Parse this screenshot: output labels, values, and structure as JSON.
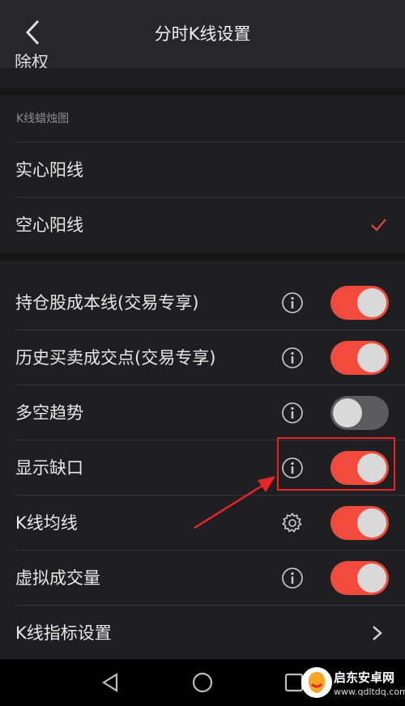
{
  "header": {
    "title": "分时K线设置",
    "peek_text": "除权"
  },
  "candle_section": {
    "label": "K线蜡烛图",
    "options": [
      {
        "label": "实心阳线",
        "selected": false
      },
      {
        "label": "空心阳线",
        "selected": true
      }
    ]
  },
  "settings": [
    {
      "label": "持仓股成本线(交易专享)",
      "icon": "info-icon",
      "on": true
    },
    {
      "label": "历史买卖成交点(交易专享)",
      "icon": "info-icon",
      "on": true
    },
    {
      "label": "多空趋势",
      "icon": "info-icon",
      "on": false
    },
    {
      "label": "显示缺口",
      "icon": "info-icon",
      "on": true
    },
    {
      "label": "K线均线",
      "icon": "gear-icon",
      "on": true
    },
    {
      "label": "虚拟成交量",
      "icon": "info-icon",
      "on": true
    }
  ],
  "indicator_row": {
    "label": "K线指标设置"
  },
  "colors": {
    "accent": "#f24a3d",
    "annotation": "#e8262a",
    "background": "#1f1f21"
  },
  "watermark": {
    "name": "启东安卓网",
    "url": "www.qdltdq.com"
  }
}
